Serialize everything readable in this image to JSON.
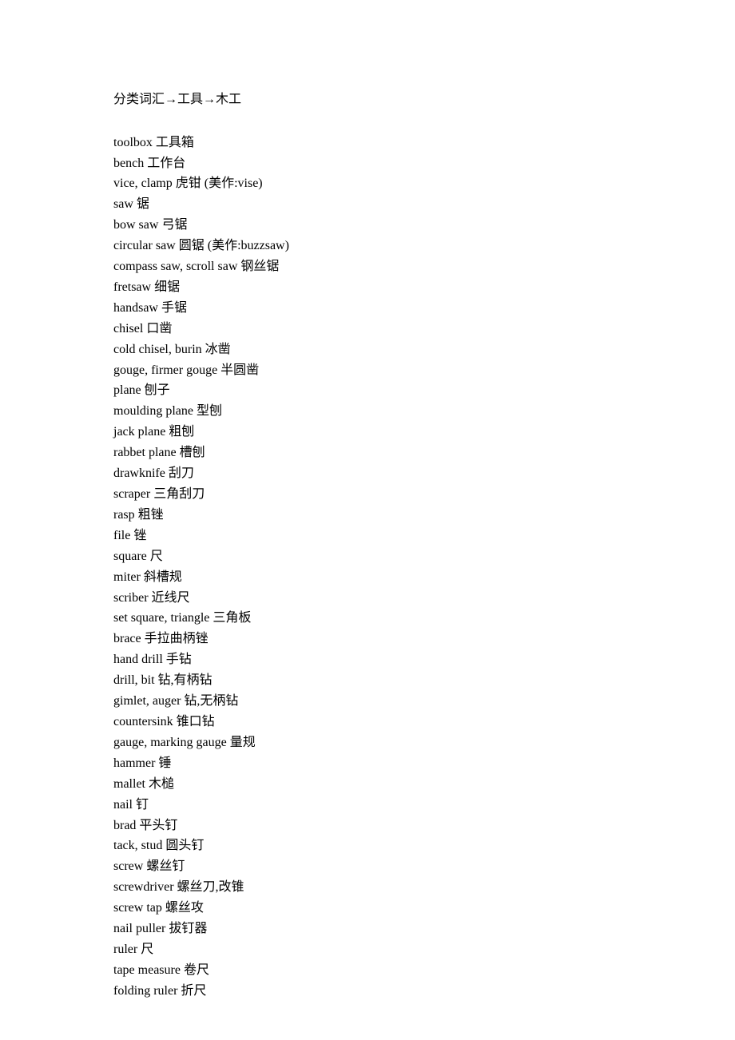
{
  "heading": "分类词汇→工具→木工",
  "entries": [
    "toolbox 工具箱",
    "bench 工作台",
    "vice, clamp 虎钳 (美作:vise)",
    "saw 锯",
    "bow saw 弓锯",
    "circular saw 圆锯 (美作:buzzsaw)",
    "compass saw, scroll saw 钢丝锯",
    "fretsaw 细锯",
    "handsaw 手锯",
    "chisel 口凿",
    "cold chisel, burin 冰凿",
    "gouge, firmer gouge 半圆凿",
    "plane 刨子",
    "moulding plane 型刨",
    "jack plane 粗刨",
    "rabbet plane 槽刨",
    "drawknife 刮刀",
    "scraper 三角刮刀",
    "rasp 粗锉",
    "file 锉",
    "square 尺",
    "miter 斜槽规",
    "scriber 近线尺",
    "set square, triangle 三角板",
    "brace 手拉曲柄锉",
    "hand drill 手钻",
    "drill, bit 钻,有柄钻",
    "gimlet, auger 钻,无柄钻",
    "countersink 锥口钻",
    "gauge, marking gauge 量规",
    "hammer 锤",
    "mallet 木槌",
    "nail 钉",
    "brad 平头钉",
    "tack, stud 圆头钉",
    "screw 螺丝钉",
    "screwdriver 螺丝刀,改锥",
    "screw tap 螺丝攻",
    "nail puller 拔钉器",
    "ruler 尺",
    "tape measure 卷尺",
    "folding ruler 折尺"
  ]
}
